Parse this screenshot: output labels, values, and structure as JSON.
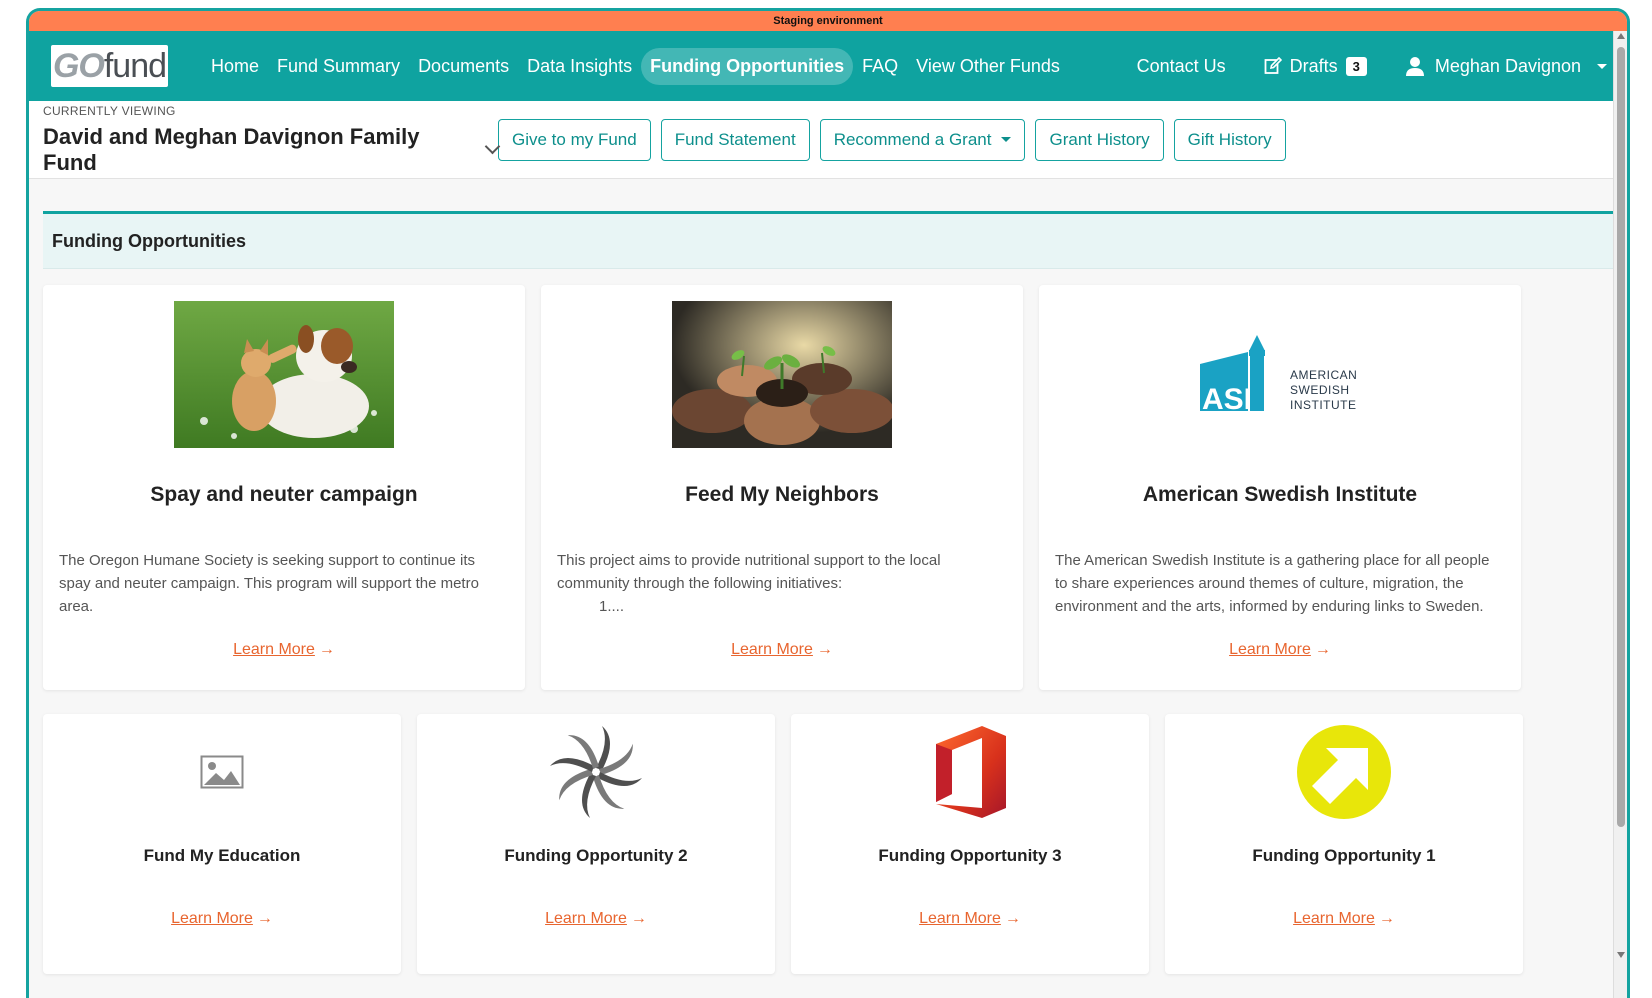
{
  "staging_banner": "Staging environment",
  "logo": {
    "go": "GO",
    "fund": "fund"
  },
  "nav": {
    "items": [
      "Home",
      "Fund Summary",
      "Documents",
      "Data Insights",
      "Funding Opportunities",
      "FAQ",
      "View Other Funds"
    ],
    "active": "Funding Opportunities",
    "contact": "Contact Us",
    "drafts_label": "Drafts",
    "drafts_count": "3",
    "user_name": "Meghan Davignon"
  },
  "subbar": {
    "currently_viewing": "CURRENTLY VIEWING",
    "fund_name": "David and Meghan Davignon Family Fund",
    "buttons": {
      "give": "Give to my Fund",
      "statement": "Fund Statement",
      "recommend": "Recommend a Grant",
      "grant_history": "Grant History",
      "gift_history": "Gift History"
    }
  },
  "section_title": "Funding Opportunities",
  "learn_more": "Learn More",
  "cards_large": [
    {
      "title": "Spay and neuter campaign",
      "desc": "The Oregon Humane Society is seeking support to continue its spay and neuter campaign. This program will support the metro area.",
      "desc_sub": ""
    },
    {
      "title": "Feed My Neighbors",
      "desc": "This project aims to provide nutritional support to the local community through the following initiatives:",
      "desc_sub": "1...."
    },
    {
      "title": "American Swedish Institute",
      "desc": "The American Swedish Institute is a gathering place for all people to share experiences around themes of culture, migration, the environment and the arts, informed by enduring links to Sweden.",
      "desc_sub": ""
    }
  ],
  "asi_logo": {
    "letters": "ASI",
    "line1": "AMERICAN",
    "line2": "SWEDISH",
    "line3": "INSTITUTE"
  },
  "cards_small": [
    {
      "title": "Fund My Education",
      "icon": "image-placeholder-icon"
    },
    {
      "title": "Funding Opportunity 2",
      "icon": "swirl-icon"
    },
    {
      "title": "Funding Opportunity 3",
      "icon": "office-icon"
    },
    {
      "title": "Funding Opportunity 1",
      "icon": "yellow-arrow-icon"
    }
  ],
  "colors": {
    "teal": "#0fa3a0",
    "staging": "#ff7f50",
    "link": "#e8652f"
  }
}
